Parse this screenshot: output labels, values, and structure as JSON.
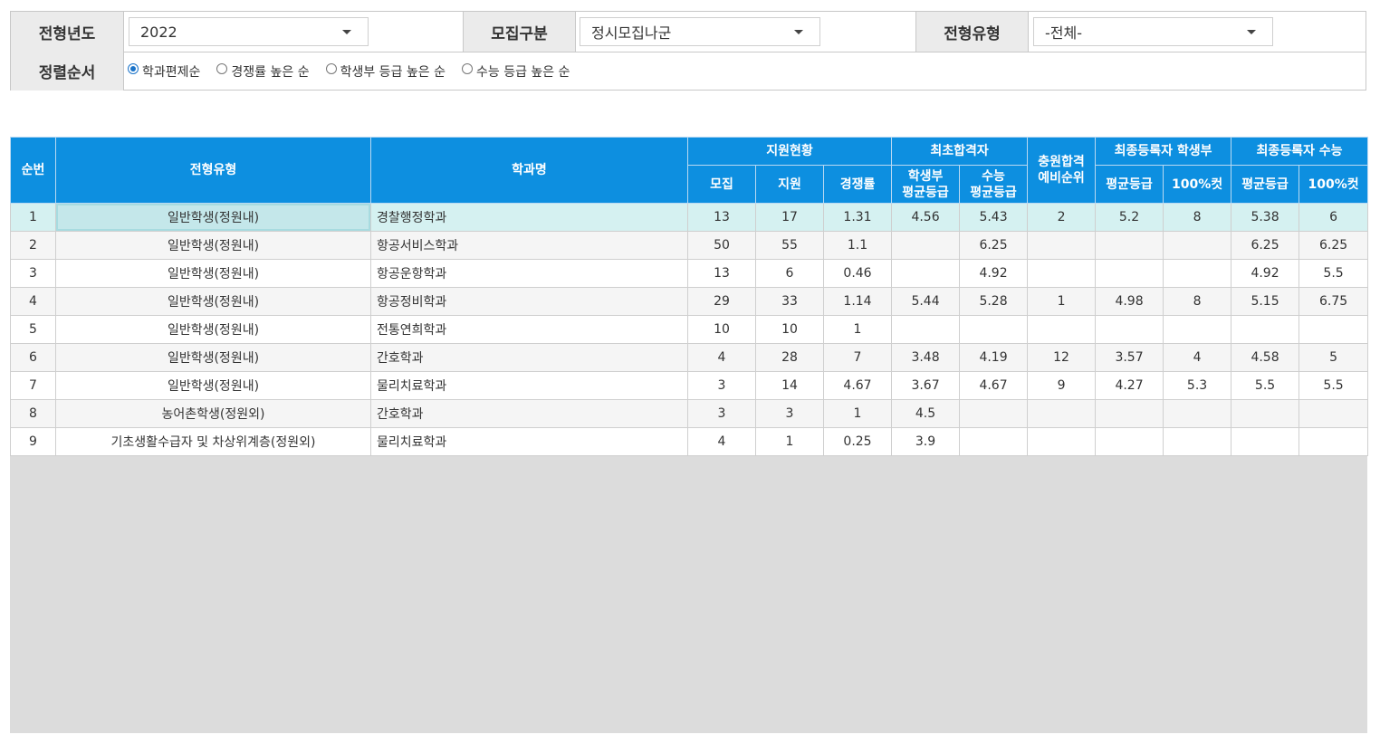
{
  "filters": {
    "year_label": "전형년도",
    "year_value": "2022",
    "recruit_label": "모집구분",
    "recruit_value": "정시모집나군",
    "type_label": "전형유형",
    "type_value": "-전체-",
    "sort_label": "정렬순서",
    "sort_options": [
      {
        "label": "학과편제순",
        "selected": true
      },
      {
        "label": "경쟁률 높은 순",
        "selected": false
      },
      {
        "label": "학생부 등급 높은 순",
        "selected": false
      },
      {
        "label": "수능 등급 높은 순",
        "selected": false
      }
    ]
  },
  "table": {
    "headers": {
      "no": "순번",
      "type": "전형유형",
      "dept": "학과명",
      "apply_group": "지원현황",
      "recruit": "모집",
      "applied": "지원",
      "ratio": "경쟁률",
      "first_group": "최초합격자",
      "first_hs_1": "학생부",
      "first_hs_2": "평균등급",
      "first_sn_1": "수능",
      "first_sn_2": "평균등급",
      "wait_1": "충원합격",
      "wait_2": "예비순위",
      "final_hs_group": "최종등록자 학생부",
      "final_sn_group": "최종등록자 수능",
      "avg": "평균등급",
      "cut": "100%컷"
    },
    "rows": [
      {
        "no": "1",
        "type": "일반학생(정원내)",
        "dept": "경찰행정학과",
        "recruit": "13",
        "applied": "17",
        "ratio": "1.31",
        "first_hs": "4.56",
        "first_sn": "5.43",
        "wait": "2",
        "fhs_avg": "5.2",
        "fhs_cut": "8",
        "fsn_avg": "5.38",
        "fsn_cut": "6"
      },
      {
        "no": "2",
        "type": "일반학생(정원내)",
        "dept": "항공서비스학과",
        "recruit": "50",
        "applied": "55",
        "ratio": "1.1",
        "first_hs": "",
        "first_sn": "6.25",
        "wait": "",
        "fhs_avg": "",
        "fhs_cut": "",
        "fsn_avg": "6.25",
        "fsn_cut": "6.25"
      },
      {
        "no": "3",
        "type": "일반학생(정원내)",
        "dept": "항공운항학과",
        "recruit": "13",
        "applied": "6",
        "ratio": "0.46",
        "first_hs": "",
        "first_sn": "4.92",
        "wait": "",
        "fhs_avg": "",
        "fhs_cut": "",
        "fsn_avg": "4.92",
        "fsn_cut": "5.5"
      },
      {
        "no": "4",
        "type": "일반학생(정원내)",
        "dept": "항공정비학과",
        "recruit": "29",
        "applied": "33",
        "ratio": "1.14",
        "first_hs": "5.44",
        "first_sn": "5.28",
        "wait": "1",
        "fhs_avg": "4.98",
        "fhs_cut": "8",
        "fsn_avg": "5.15",
        "fsn_cut": "6.75"
      },
      {
        "no": "5",
        "type": "일반학생(정원내)",
        "dept": "전통연희학과",
        "recruit": "10",
        "applied": "10",
        "ratio": "1",
        "first_hs": "",
        "first_sn": "",
        "wait": "",
        "fhs_avg": "",
        "fhs_cut": "",
        "fsn_avg": "",
        "fsn_cut": ""
      },
      {
        "no": "6",
        "type": "일반학생(정원내)",
        "dept": "간호학과",
        "recruit": "4",
        "applied": "28",
        "ratio": "7",
        "first_hs": "3.48",
        "first_sn": "4.19",
        "wait": "12",
        "fhs_avg": "3.57",
        "fhs_cut": "4",
        "fsn_avg": "4.58",
        "fsn_cut": "5"
      },
      {
        "no": "7",
        "type": "일반학생(정원내)",
        "dept": "물리치료학과",
        "recruit": "3",
        "applied": "14",
        "ratio": "4.67",
        "first_hs": "3.67",
        "first_sn": "4.67",
        "wait": "9",
        "fhs_avg": "4.27",
        "fhs_cut": "5.3",
        "fsn_avg": "5.5",
        "fsn_cut": "5.5"
      },
      {
        "no": "8",
        "type": "농어촌학생(정원외)",
        "dept": "간호학과",
        "recruit": "3",
        "applied": "3",
        "ratio": "1",
        "first_hs": "4.5",
        "first_sn": "",
        "wait": "",
        "fhs_avg": "",
        "fhs_cut": "",
        "fsn_avg": "",
        "fsn_cut": ""
      },
      {
        "no": "9",
        "type": "기초생활수급자 및 차상위계층(정원외)",
        "dept": "물리치료학과",
        "recruit": "4",
        "applied": "1",
        "ratio": "0.25",
        "first_hs": "3.9",
        "first_sn": "",
        "wait": "",
        "fhs_avg": "",
        "fhs_cut": "",
        "fsn_avg": "",
        "fsn_cut": ""
      }
    ]
  }
}
